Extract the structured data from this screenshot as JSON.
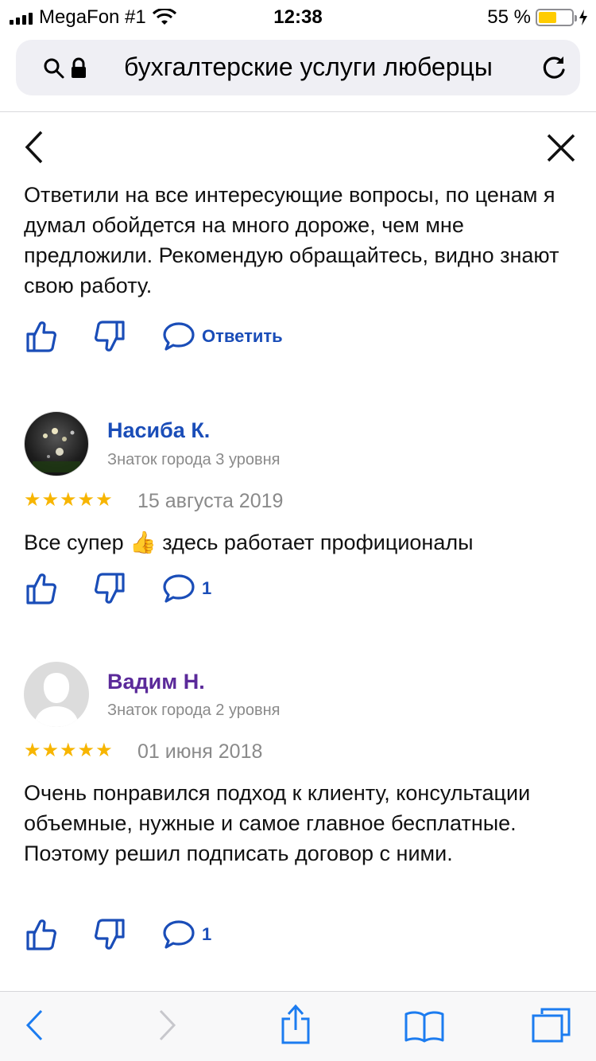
{
  "status_bar": {
    "carrier": "MegaFon #1",
    "time": "12:38",
    "battery_percent": "55 %",
    "battery_level": 0.55
  },
  "browser": {
    "url_text": "бухгалтерские услуги люберцы"
  },
  "reviews": [
    {
      "text": "Ответили на все интересующие вопросы, по ценам я думал обойдется на много дороже, чем мне предложили. Рекомендую обращайтесь, видно знают свою работу.",
      "reply_label": "Ответить"
    },
    {
      "author": "Насиба К.",
      "author_color": "#1a4db8",
      "level": "Знаток города 3 уровня",
      "stars": "★★★★★",
      "rating": 5,
      "date": "15 августа 2019",
      "text": "Все супер 👍 здесь работает профиционалы",
      "comment_count": "1"
    },
    {
      "author": "Вадим Н.",
      "author_color": "#5b2a9a",
      "level": "Знаток города 2 уровня",
      "stars": "★★★★★",
      "rating": 5,
      "date": "01 июня 2018",
      "text": "Очень понравился подход к клиенту, консультации объемные, нужные и самое главное бесплатные. Поэтому решил подписать договор с ними.",
      "comment_count": "1"
    }
  ],
  "icons": {
    "like": "thumbs-up-icon",
    "dislike": "thumbs-down-icon",
    "comment": "comment-bubble-icon",
    "back": "chevron-left-icon",
    "close": "close-icon"
  },
  "colors": {
    "accent_blue": "#1a4db8",
    "star_yellow": "#f7b500",
    "browser_blue": "#1c7cf0"
  }
}
